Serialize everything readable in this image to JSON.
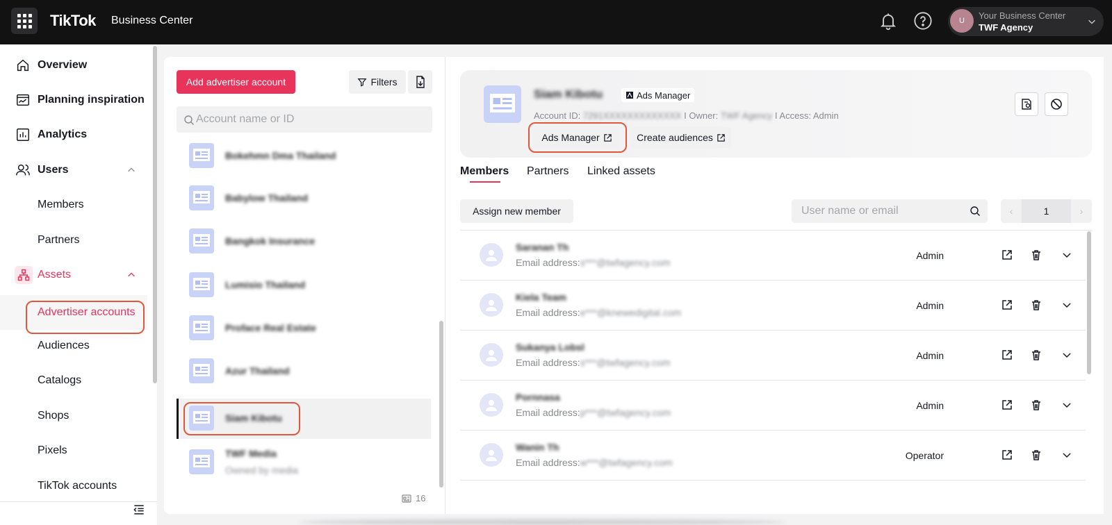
{
  "header": {
    "brand": "TikTok",
    "brand_suffix": "Business Center",
    "account": {
      "avatar_letter": "U",
      "label": "Your Business Center",
      "name": "TWF Agency"
    }
  },
  "sidebar": {
    "items": [
      {
        "label": "Overview",
        "icon": "home-icon"
      },
      {
        "label": "Planning inspiration",
        "icon": "chart-window-icon"
      },
      {
        "label": "Analytics",
        "icon": "bar-chart-icon"
      },
      {
        "label": "Users",
        "icon": "users-icon"
      },
      {
        "label": "Members"
      },
      {
        "label": "Partners"
      },
      {
        "label": "Assets",
        "icon": "assets-icon"
      },
      {
        "label": "Advertiser accounts"
      },
      {
        "label": "Audiences"
      },
      {
        "label": "Catalogs"
      },
      {
        "label": "Shops"
      },
      {
        "label": "Pixels"
      },
      {
        "label": "TikTok accounts"
      }
    ]
  },
  "accounts_panel": {
    "add_button": "Add advertiser account",
    "filters_button": "Filters",
    "search_placeholder": "Account name or ID",
    "accounts": [
      {
        "name": "Bokehmn Dma Thailand"
      },
      {
        "name": "Babylow Thailand"
      },
      {
        "name": "Bangkok Insurance"
      },
      {
        "name": "Lumisio Thailand"
      },
      {
        "name": "Proface Real Estate"
      },
      {
        "name": "Azur Thailand"
      },
      {
        "name": "Siam Kibotu",
        "selected": true
      },
      {
        "name": "TWF Media",
        "sub": "Owned by media"
      }
    ],
    "count": "16"
  },
  "account_detail": {
    "name": "Siam Kibotu",
    "tag": "Ads Manager",
    "account_id_label": "Account ID:",
    "account_id": "7291XXXXXXXXXXXXX",
    "owner_label": "I Owner:",
    "owner": "TWF Agency",
    "access": "I Access: Admin",
    "ads_manager_button": "Ads Manager",
    "create_audiences_button": "Create audiences",
    "tabs": [
      "Members",
      "Partners",
      "Linked assets"
    ],
    "assign_button": "Assign new member",
    "member_search_placeholder": "User name or email",
    "page": "1",
    "email_label": "Email address:",
    "members": [
      {
        "name": "Saranan Th",
        "email": "s***@twfagency.com",
        "role": "Admin"
      },
      {
        "name": "Kiela Team",
        "email": "e***@knewedigital.com",
        "role": "Admin"
      },
      {
        "name": "Sukanya Lobsl",
        "email": "s***@twfagency.com",
        "role": "Admin"
      },
      {
        "name": "Pornnasa",
        "email": "p***@twfagency.com",
        "role": "Admin"
      },
      {
        "name": "Wanin Th",
        "email": "w***@twfagency.com",
        "role": "Operator"
      }
    ]
  },
  "colors": {
    "accent": "#e8335a",
    "highlight_outline": "#e0573c"
  }
}
